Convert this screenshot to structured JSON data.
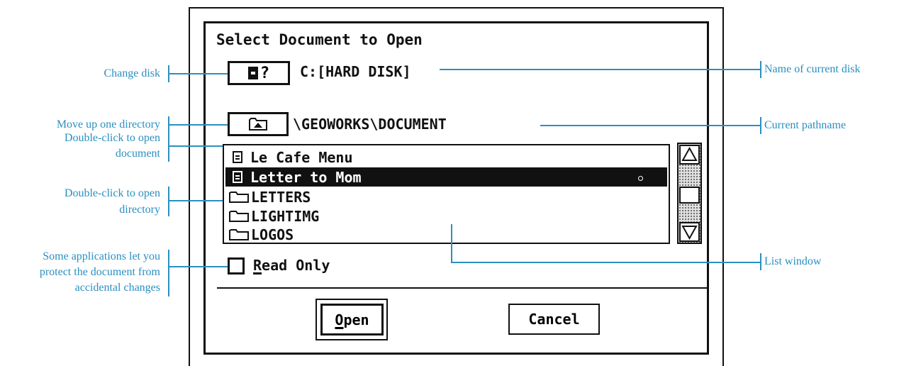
{
  "dialog": {
    "title": "Select Document to Open",
    "disk_button_label": "?",
    "disk_name": "C:[HARD DISK]",
    "path": "\\GEOWORKS\\DOCUMENT",
    "items": [
      {
        "icon": "document-icon",
        "label": "Le Cafe Menu",
        "selected": false
      },
      {
        "icon": "document-icon",
        "label": "Letter to Mom",
        "selected": true
      },
      {
        "icon": "folder-icon",
        "label": "LETTERS",
        "selected": false
      },
      {
        "icon": "folder-icon",
        "label": "LIGHTIMG",
        "selected": false
      },
      {
        "icon": "folder-icon",
        "label": "LOGOS",
        "selected": false
      }
    ],
    "read_only_label_first": "R",
    "read_only_label_rest": "ead Only",
    "open_label_first": "O",
    "open_label_rest": "pen",
    "cancel_label": "Cancel"
  },
  "annotations": {
    "change_disk": "Change disk",
    "move_up": "Move up one directory",
    "open_document_1": "Double-click to open",
    "open_document_2": "document",
    "open_directory_1": "Double-click to open",
    "open_directory_2": "directory",
    "protect_1": "Some applications let you",
    "protect_2": "protect the document from",
    "protect_3": "accidental changes",
    "disk_name": "Name of current disk",
    "pathname": "Current pathname",
    "list_window": "List window"
  },
  "colors": {
    "annotation": "#2a8fc2",
    "ink": "#111111"
  }
}
